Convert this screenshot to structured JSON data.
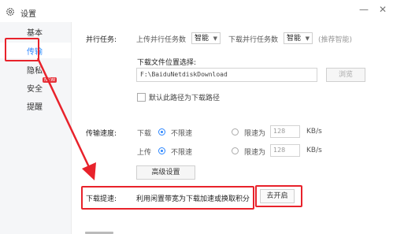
{
  "window": {
    "title": "设置",
    "minimize": "—",
    "close": "✕"
  },
  "sidebar": {
    "items": [
      {
        "label": "基本"
      },
      {
        "label": "传输"
      },
      {
        "label": "隐私"
      },
      {
        "label": "安全",
        "badge": "NEW"
      },
      {
        "label": "提醒"
      }
    ],
    "active": "传输"
  },
  "parallel": {
    "label": "并行任务:",
    "upload_label": "上传并行任务数",
    "upload_value": "智能",
    "download_label": "下载并行任务数",
    "download_value": "智能",
    "hint": "(推荐智能)"
  },
  "download_location": {
    "label": "下载文件位置选择:",
    "path": "F:\\BaiduNetdiskDownload",
    "browse_label": "浏览",
    "default_checkbox_label": "默认此路径为下载路径",
    "default_checked": false
  },
  "speed": {
    "label": "传输速度:",
    "download_label": "下载",
    "upload_label": "上传",
    "unlimited_label": "不限速",
    "limit_label": "限速为",
    "download_limit": "128",
    "upload_limit": "128",
    "unit": "KB/s",
    "download_mode": "unlimited",
    "upload_mode": "unlimited",
    "advanced_button": "高级设置"
  },
  "boost": {
    "label": "下载提速:",
    "description": "利用闲置带宽为下载加速或换取积分",
    "button": "去开启"
  },
  "colors": {
    "accent": "#2c86ff",
    "annotation": "#e8222b"
  }
}
